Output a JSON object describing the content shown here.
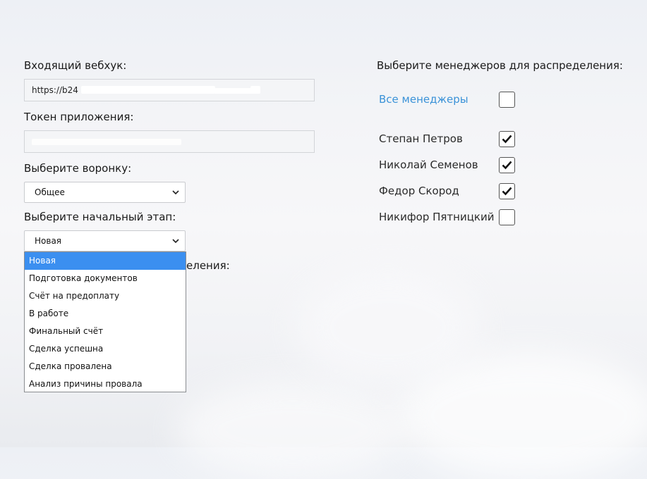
{
  "form": {
    "webhook_label": "Входящий вебхук:",
    "webhook_value": "https://b24",
    "token_label": "Токен приложения:",
    "funnel_label": "Выберите воронку:",
    "funnel_selected": "Общее",
    "stage_label": "Выберите начальный этап:",
    "stage_selected": "Новая",
    "hidden_label_tail": "еления:"
  },
  "stage_options": [
    "Новая",
    "Подготовка документов",
    "Счёт на предоплату",
    "В работе",
    "Финальный счёт",
    "Сделка успешна",
    "Сделка провалена",
    "Анализ причины провала"
  ],
  "managers": {
    "title": "Выберите менеджеров для распределения:",
    "all_label": "Все менеджеры",
    "all_checked": false,
    "list": [
      {
        "name": "Степан Петров",
        "checked": true
      },
      {
        "name": "Николай Семенов",
        "checked": true
      },
      {
        "name": "Федор Скород",
        "checked": true
      },
      {
        "name": "Никифор Пятницкий",
        "checked": false
      }
    ]
  },
  "colors": {
    "accent_link": "#3a92d8",
    "selected_option_bg": "#3b8ff0"
  }
}
